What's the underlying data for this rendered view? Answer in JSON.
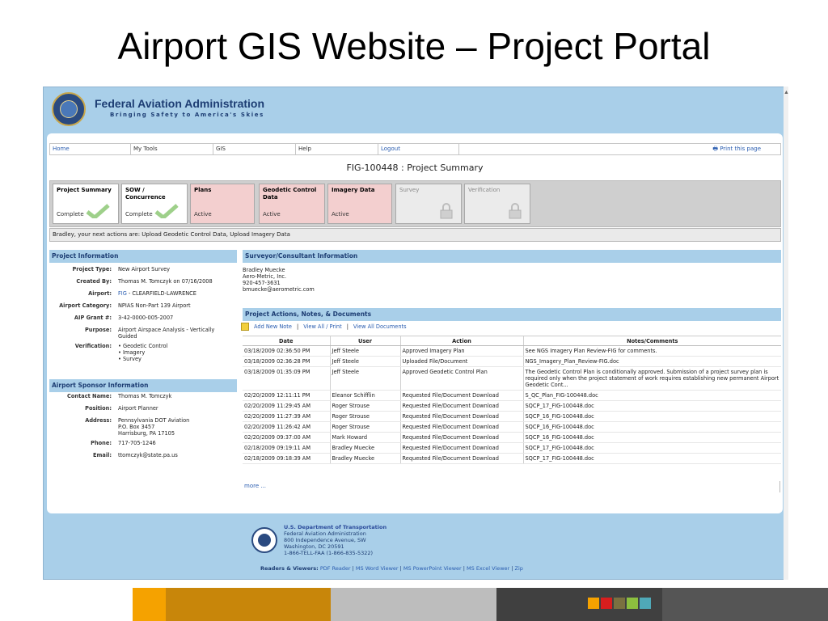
{
  "slide": {
    "title": "Airport GIS Website – Project Portal"
  },
  "faa": {
    "name": "Federal Aviation Administration",
    "tagline": "Bringing Safety to America's Skies"
  },
  "nav": {
    "home": "Home",
    "my_tools": "My Tools",
    "gis": "GIS",
    "help": "Help",
    "logout": "Logout",
    "print": "Print this page"
  },
  "page_header": "FIG-100448 : Project Summary",
  "tabs": [
    {
      "title": "Project Summary",
      "status": "Complete"
    },
    {
      "title": "SOW / Concurrence",
      "status": "Complete"
    },
    {
      "title": "Plans",
      "status": "Active"
    },
    {
      "title": "Geodetic Control Data",
      "status": "Active"
    },
    {
      "title": "Imagery Data",
      "status": "Active"
    },
    {
      "title": "Survey",
      "status": ""
    },
    {
      "title": "Verification",
      "status": ""
    }
  ],
  "next_actions": "Bradley, your next actions are:  Upload Geodetic Control Data,  Upload Imagery Data",
  "project_info": {
    "heading": "Project Information",
    "type_k": "Project Type:",
    "type_v": "New Airport Survey",
    "created_k": "Created By:",
    "created_v": "Thomas M. Tomczyk on 07/16/2008",
    "airport_k": "Airport:",
    "airport_code": "FIG",
    "airport_v": " - CLEARFIELD-LAWRENCE",
    "category_k": "Airport Category:",
    "category_v": "NPIAS Non-Part 139 Airport",
    "aip_k": "AIP Grant #:",
    "aip_v": "3-42-0000-005-2007",
    "purpose_k": "Purpose:",
    "purpose_v1": "Airport Airspace Analysis - Vertically",
    "purpose_v2": "Guided",
    "verif_k": "Verification:",
    "verif_v1": "• Geodetic Control",
    "verif_v2": "• Imagery",
    "verif_v3": "• Survey"
  },
  "sponsor": {
    "heading": "Airport Sponsor Information",
    "contact_k": "Contact Name:",
    "contact_v": "Thomas M. Tomczyk",
    "position_k": "Position:",
    "position_v": "Airport Planner",
    "address_k": "Address:",
    "address_v1": "Pennsylvania DOT Aviation",
    "address_v2": "P.O. Box 3457",
    "address_v3": "Harrisburg, PA 17105",
    "phone_k": "Phone:",
    "phone_v": "717-705-1246",
    "email_k": "Email:",
    "email_v": "ttomczyk@state.pa.us"
  },
  "surveyor": {
    "heading": "Surveyor/Consultant Information",
    "line1": "Bradley Muecke",
    "line2": "Aero-Metric, Inc.",
    "line3": "920-457-3631",
    "line4": "bmuecke@aerometric.com"
  },
  "actions": {
    "heading": "Project Actions, Notes, & Documents",
    "add_note": "Add New Note",
    "view_all_print": "View All / Print",
    "view_docs": "View All Documents",
    "col_date": "Date",
    "col_user": "User",
    "col_action": "Action",
    "col_notes": "Notes/Comments",
    "rows": [
      {
        "date": "03/18/2009 02:36:50 PM",
        "user": "Jeff Steele",
        "action": "Approved Imagery Plan",
        "notes": "See NGS Imagery Plan Review-FIG for comments."
      },
      {
        "date": "03/18/2009 02:36:28 PM",
        "user": "Jeff Steele",
        "action": "Uploaded File/Document",
        "notes": "NGS_Imagery_Plan_Review-FIG.doc"
      },
      {
        "date": "03/18/2009 01:35:09 PM",
        "user": "Jeff Steele",
        "action": "Approved Geodetic Control Plan",
        "notes": "The Geodetic Control Plan is conditionally approved. Submission of a project survey plan is required only when the project statement of work requires establishing new permanent Airport Geodetic Cont..."
      },
      {
        "date": "02/20/2009 12:11:11 PM",
        "user": "Eleanor Schifflin",
        "action": "Requested File/Document Download",
        "notes": "S_QC_Plan_FIG-100448.doc"
      },
      {
        "date": "02/20/2009 11:29:45 AM",
        "user": "Roger Strouse",
        "action": "Requested File/Document Download",
        "notes": "SQCP_17_FIG-100448.doc"
      },
      {
        "date": "02/20/2009 11:27:39 AM",
        "user": "Roger Strouse",
        "action": "Requested File/Document Download",
        "notes": "SQCP_16_FIG-100448.doc"
      },
      {
        "date": "02/20/2009 11:26:42 AM",
        "user": "Roger Strouse",
        "action": "Requested File/Document Download",
        "notes": "SQCP_16_FIG-100448.doc"
      },
      {
        "date": "02/20/2009 09:37:00 AM",
        "user": "Mark Howard",
        "action": "Requested File/Document Download",
        "notes": "SQCP_16_FIG-100448.doc"
      },
      {
        "date": "02/18/2009 09:19:11 AM",
        "user": "Bradley Muecke",
        "action": "Requested File/Document Download",
        "notes": "SQCP_17_FIG-100448.doc"
      },
      {
        "date": "02/18/2009 09:18:39 AM",
        "user": "Bradley Muecke",
        "action": "Requested File/Document Download",
        "notes": "SQCP_17_FIG-100448.doc"
      }
    ],
    "more": "more ..."
  },
  "footer": {
    "dept": "U.S. Department of Transportation",
    "l1": "Federal Aviation Administration",
    "l2": "800 Independence Avenue, SW",
    "l3": "Washington, DC 20591",
    "l4": "1-866-TELL-FAA (1-866-835-5322)",
    "viewers_label": "Readers & Viewers:",
    "v1": "PDF Reader",
    "v2": "MS Word Viewer",
    "v3": "MS PowerPoint Viewer",
    "v4": "MS Excel Viewer",
    "v5": "Zip"
  },
  "colors": {
    "band_orange": "#f5a200",
    "band_brown": "#c8860a",
    "band_grey": "#bdbdbd",
    "band_dark": "#404040",
    "band_darker": "#555555",
    "sq1": "#f5a200",
    "sq2": "#d81e1e",
    "sq3": "#7a7040",
    "sq4": "#8cbf3f",
    "sq5": "#4fa9b8"
  }
}
